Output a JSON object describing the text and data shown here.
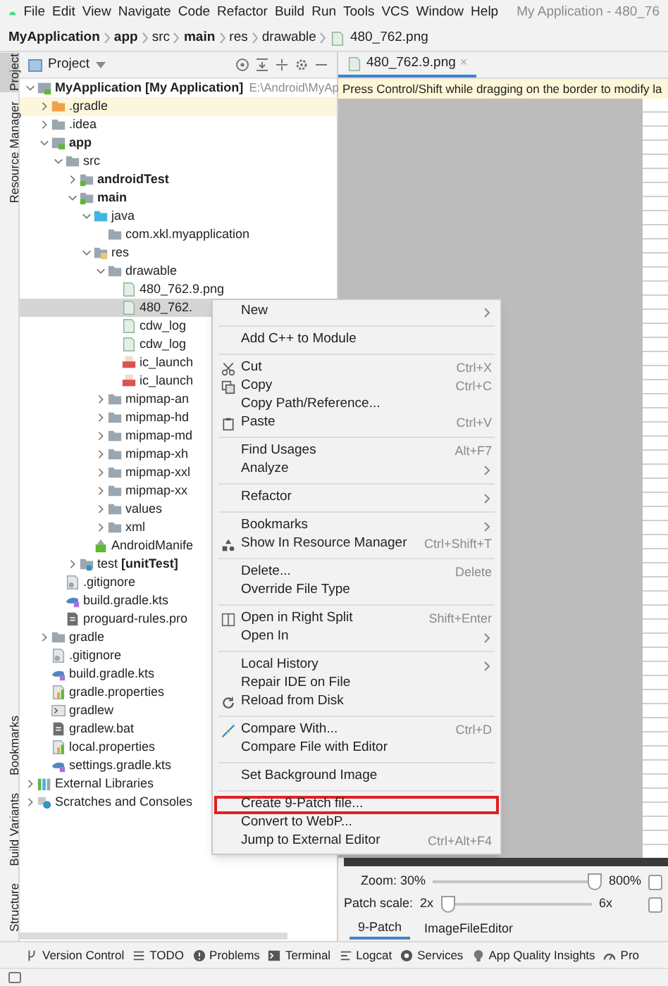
{
  "menu_bar": {
    "items": [
      "File",
      "Edit",
      "View",
      "Navigate",
      "Code",
      "Refactor",
      "Build",
      "Run",
      "Tools",
      "VCS",
      "Window",
      "Help"
    ],
    "title": "My Application - 480_76"
  },
  "breadcrumb": [
    {
      "label": "MyApplication",
      "bold": true
    },
    {
      "label": "app",
      "bold": true
    },
    {
      "label": "src",
      "bold": false
    },
    {
      "label": "main",
      "bold": true
    },
    {
      "label": "res",
      "bold": false
    },
    {
      "label": "drawable",
      "bold": false
    },
    {
      "label": "480_762.png",
      "bold": false,
      "kind": "file"
    }
  ],
  "side_strip": {
    "top": [
      {
        "label": "Project",
        "selected": true
      },
      {
        "label": "Resource Manager",
        "selected": false
      }
    ],
    "bottom": [
      {
        "label": "Bookmarks",
        "selected": false
      },
      {
        "label": "Build Variants",
        "selected": false
      },
      {
        "label": "Structure",
        "selected": false
      }
    ]
  },
  "project_panel": {
    "title": "Project",
    "tree": [
      {
        "name": "MyApplication **[My Application]**",
        "path": "E:\\Android\\MyAp",
        "kind": "module",
        "expanded": true,
        "selected": false,
        "children": [
          {
            "name": ".gradle",
            "kind": "excluded",
            "expanded": false,
            "selected": false
          },
          {
            "name": ".idea",
            "kind": "folder",
            "expanded": false,
            "selected": false
          },
          {
            "name": "app",
            "kind": "module",
            "expanded": true,
            "selected": false,
            "children": [
              {
                "name": "src",
                "kind": "folder",
                "expanded": true,
                "selected": false,
                "children": [
                  {
                    "name": "androidTest",
                    "kind": "sourceset",
                    "expanded": false,
                    "selected": false
                  },
                  {
                    "name": "main",
                    "kind": "sourceset",
                    "expanded": true,
                    "selected": false,
                    "children": [
                      {
                        "name": "java",
                        "kind": "source",
                        "expanded": true,
                        "selected": false,
                        "children": [
                          {
                            "name": "com.xkl.myapplication",
                            "kind": "folder",
                            "selected": false
                          }
                        ]
                      },
                      {
                        "name": "res",
                        "kind": "res",
                        "expanded": true,
                        "selected": false,
                        "children": [
                          {
                            "name": "drawable",
                            "kind": "folder",
                            "expanded": true,
                            "selected": false,
                            "children": [
                              {
                                "name": "480_762.9.png",
                                "kind": "image",
                                "selected": false
                              },
                              {
                                "name": "480_762.",
                                "kind": "image",
                                "selected": true
                              },
                              {
                                "name": "cdw_log",
                                "kind": "image",
                                "selected": false
                              },
                              {
                                "name": "cdw_log",
                                "kind": "image",
                                "selected": false
                              },
                              {
                                "name": "ic_launch",
                                "kind": "launcher",
                                "selected": false
                              },
                              {
                                "name": "ic_launch",
                                "kind": "launcher",
                                "selected": false
                              }
                            ]
                          },
                          {
                            "name": "mipmap-an",
                            "kind": "folder",
                            "expanded": false,
                            "selected": false
                          },
                          {
                            "name": "mipmap-hd",
                            "kind": "folder",
                            "expanded": false,
                            "selected": false
                          },
                          {
                            "name": "mipmap-md",
                            "kind": "folder",
                            "expanded": false,
                            "selected": false
                          },
                          {
                            "name": "mipmap-xh",
                            "kind": "folder",
                            "expanded": false,
                            "selected": false
                          },
                          {
                            "name": "mipmap-xxl",
                            "kind": "folder",
                            "expanded": false,
                            "selected": false
                          },
                          {
                            "name": "mipmap-xx",
                            "kind": "folder",
                            "expanded": false,
                            "selected": false
                          },
                          {
                            "name": "values",
                            "kind": "folder",
                            "expanded": false,
                            "selected": false
                          },
                          {
                            "name": "xml",
                            "kind": "folder",
                            "expanded": false,
                            "selected": false
                          }
                        ]
                      },
                      {
                        "name": "AndroidManife",
                        "kind": "manifest",
                        "selected": false
                      }
                    ]
                  },
                  {
                    "name": "test **[unitTest]**",
                    "kind": "testset",
                    "expanded": false,
                    "selected": false
                  }
                ]
              },
              {
                "name": ".gitignore",
                "kind": "gitignore",
                "selected": false
              },
              {
                "name": "build.gradle.kts",
                "kind": "gradle",
                "selected": false
              },
              {
                "name": "proguard-rules.pro",
                "kind": "file",
                "selected": false
              }
            ]
          },
          {
            "name": "gradle",
            "kind": "folder",
            "expanded": false,
            "selected": false
          },
          {
            "name": ".gitignore",
            "kind": "gitignore",
            "selected": false
          },
          {
            "name": "build.gradle.kts",
            "kind": "gradle",
            "selected": false
          },
          {
            "name": "gradle.properties",
            "kind": "properties",
            "selected": false
          },
          {
            "name": "gradlew",
            "kind": "shell",
            "selected": false
          },
          {
            "name": "gradlew.bat",
            "kind": "file",
            "selected": false
          },
          {
            "name": "local.properties",
            "kind": "properties",
            "selected": false
          },
          {
            "name": "settings.gradle.kts",
            "kind": "gradle",
            "selected": false
          }
        ]
      },
      {
        "name": "External Libraries",
        "kind": "library",
        "expanded": false,
        "selected": false
      },
      {
        "name": "Scratches and Consoles",
        "kind": "scratches",
        "expanded": false,
        "selected": false
      }
    ]
  },
  "editor": {
    "tab": {
      "label": "480_762.9.png",
      "close": "×"
    },
    "notice": "Press Control/Shift while dragging on the border to modify la",
    "zoom": {
      "label": "Zoom: 30%",
      "max": "800%",
      "level": 1,
      "checked": false
    },
    "patch_scale": {
      "label": "Patch scale:",
      "min": "2x",
      "max": "6x",
      "level": 0,
      "checked": false
    },
    "tabs": [
      {
        "label": "9-Patch",
        "selected": true
      },
      {
        "label": "ImageFileEditor",
        "selected": false
      }
    ]
  },
  "context_menu": {
    "groups": [
      [
        {
          "label": "New",
          "submenu": true,
          "outlined": false
        }
      ],
      [
        {
          "label": "Add C++ to Module",
          "submenu": false,
          "outlined": false
        }
      ],
      [
        {
          "label": "Cut",
          "shortcut": "Ctrl+X",
          "kind": "cut",
          "submenu": false,
          "outlined": false
        },
        {
          "label": "Copy",
          "shortcut": "Ctrl+C",
          "kind": "copy",
          "submenu": false,
          "outlined": false
        },
        {
          "label": "Copy Path/Reference...",
          "submenu": false,
          "outlined": false
        },
        {
          "label": "Paste",
          "shortcut": "Ctrl+V",
          "kind": "paste",
          "submenu": false,
          "outlined": false
        }
      ],
      [
        {
          "label": "Find Usages",
          "shortcut": "Alt+F7",
          "submenu": false,
          "outlined": false
        },
        {
          "label": "Analyze",
          "submenu": true,
          "outlined": false
        }
      ],
      [
        {
          "label": "Refactor",
          "submenu": true,
          "outlined": false
        }
      ],
      [
        {
          "label": "Bookmarks",
          "submenu": true,
          "outlined": false
        },
        {
          "label": "Show In Resource Manager",
          "shortcut": "Ctrl+Shift+T",
          "kind": "resources",
          "submenu": false,
          "outlined": false
        }
      ],
      [
        {
          "label": "Delete...",
          "shortcut": "Delete",
          "submenu": false,
          "outlined": false
        },
        {
          "label": "Override File Type",
          "submenu": false,
          "outlined": false
        }
      ],
      [
        {
          "label": "Open in Right Split",
          "shortcut": "Shift+Enter",
          "kind": "split",
          "submenu": false,
          "outlined": false
        },
        {
          "label": "Open In",
          "submenu": true,
          "outlined": false
        }
      ],
      [
        {
          "label": "Local History",
          "submenu": true,
          "outlined": false
        },
        {
          "label": "Repair IDE on File",
          "submenu": false,
          "outlined": false
        },
        {
          "label": "Reload from Disk",
          "kind": "reload",
          "submenu": false,
          "outlined": false
        }
      ],
      [
        {
          "label": "Compare With...",
          "shortcut": "Ctrl+D",
          "kind": "compare",
          "submenu": false,
          "outlined": false
        },
        {
          "label": "Compare File with Editor",
          "submenu": false,
          "outlined": false
        }
      ],
      [
        {
          "label": "Set Background Image",
          "submenu": false,
          "outlined": false
        }
      ],
      [
        {
          "label": "Create 9-Patch file...",
          "submenu": false,
          "outlined": true
        },
        {
          "label": "Convert to WebP...",
          "submenu": false,
          "outlined": false
        },
        {
          "label": "Jump to External Editor",
          "shortcut": "Ctrl+Alt+F4",
          "submenu": false,
          "outlined": false
        }
      ]
    ]
  },
  "tool_windows": [
    {
      "label": "Version Control",
      "kind": "vcs"
    },
    {
      "label": "TODO",
      "kind": "list"
    },
    {
      "label": "Problems",
      "kind": "problems"
    },
    {
      "label": "Terminal",
      "kind": "terminal"
    },
    {
      "label": "Logcat",
      "kind": "logcat"
    },
    {
      "label": "Services",
      "kind": "services"
    },
    {
      "label": "App Quality Insights",
      "kind": "insights"
    },
    {
      "label": "Pro",
      "kind": "profiler"
    }
  ]
}
